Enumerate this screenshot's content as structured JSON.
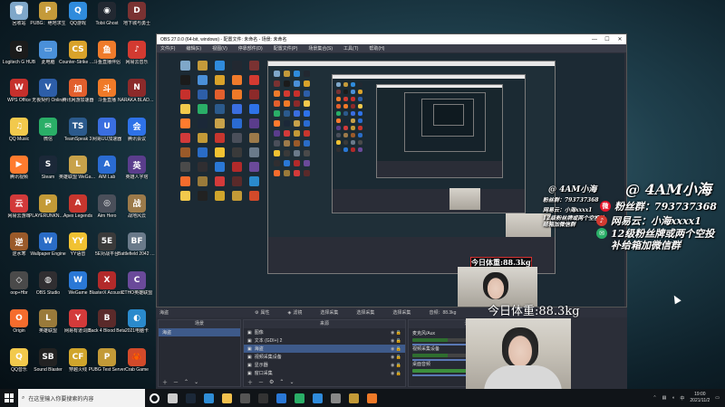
{
  "desktop_icons": [
    {
      "label": "回收站",
      "color": "#7fa7c9",
      "glyph": "🗑"
    },
    {
      "label": "PUBG：绝地求生",
      "color": "#c49a3a",
      "glyph": "P"
    },
    {
      "label": "QQ游戏",
      "color": "#2f8bdc",
      "glyph": "Q"
    },
    {
      "label": "Tobii Ghost",
      "color": "#222831",
      "glyph": "◉"
    },
    {
      "label": "地下城与勇士",
      "color": "#7a3232",
      "glyph": "D"
    },
    {
      "label": "Logitech G HUB",
      "color": "#1b1b1b",
      "glyph": "G"
    },
    {
      "label": "此电脑",
      "color": "#4a90d9",
      "glyph": "▭"
    },
    {
      "label": "Counter-Strike Global Off...",
      "color": "#d9a22a",
      "glyph": "CS"
    },
    {
      "label": "斗鱼直播伴侣",
      "color": "#ef7b2b",
      "glyph": "鱼"
    },
    {
      "label": "网易云音乐",
      "color": "#d33a31",
      "glyph": "♪"
    },
    {
      "label": "WPS Office",
      "color": "#c6302c",
      "glyph": "W"
    },
    {
      "label": "无畏契约 Online",
      "color": "#2d5ea8",
      "glyph": "V"
    },
    {
      "label": "腾讯网游加速器",
      "color": "#e25f2d",
      "glyph": "加"
    },
    {
      "label": "斗鱼直播",
      "color": "#f07a28",
      "glyph": "斗"
    },
    {
      "label": "NARAKA BLADEPOINT",
      "color": "#8c2a2a",
      "glyph": "N"
    },
    {
      "label": "QQ Music",
      "color": "#f2c94c",
      "glyph": "♫"
    },
    {
      "label": "微信",
      "color": "#2aae67",
      "glyph": "✉"
    },
    {
      "label": "TeamSpeak 3",
      "color": "#2b5a8c",
      "glyph": "TS"
    },
    {
      "label": "网易UU加速器",
      "color": "#3a6ee0",
      "glyph": "U"
    },
    {
      "label": "腾讯会议",
      "color": "#2e72e8",
      "glyph": "会"
    },
    {
      "label": "腾讯视频",
      "color": "#ff7b2e",
      "glyph": "▶"
    },
    {
      "label": "Steam",
      "color": "#1b2838",
      "glyph": "S"
    },
    {
      "label": "英雄联盟 WeGame",
      "color": "#c8a24a",
      "glyph": "L"
    },
    {
      "label": "AIM Lab",
      "color": "#2a6bd1",
      "glyph": "A"
    },
    {
      "label": "英雄人字塔",
      "color": "#5a3d8c",
      "glyph": "英"
    },
    {
      "label": "网易云游戏",
      "color": "#d23a3a",
      "glyph": "云"
    },
    {
      "label": "PLAYERUNKNOWN'S BATTLEGROUNDS",
      "color": "#c39a37",
      "glyph": "P"
    },
    {
      "label": "Apex Legends",
      "color": "#c7362e",
      "glyph": "A"
    },
    {
      "label": "Aim Hero",
      "color": "#4a4f5a",
      "glyph": "◎"
    },
    {
      "label": "战地风云",
      "color": "#9c7a4a",
      "glyph": "战"
    },
    {
      "label": "逆水寒",
      "color": "#9a5a2a",
      "glyph": "逆"
    },
    {
      "label": "Wallpaper Engine",
      "color": "#2a6cc6",
      "glyph": "W"
    },
    {
      "label": "YY语音",
      "color": "#f1c232",
      "glyph": "YY"
    },
    {
      "label": "5E对战平台",
      "color": "#3a3a3a",
      "glyph": "5E"
    },
    {
      "label": "Battlefield 2042 Open...",
      "color": "#6a7a8a",
      "glyph": "BF"
    },
    {
      "label": "oop+Hbr",
      "color": "#4a4a4a",
      "glyph": "◇"
    },
    {
      "label": "OBS Studio",
      "color": "#302e31",
      "glyph": "◍"
    },
    {
      "label": "WeGame",
      "color": "#2a78d6",
      "glyph": "W"
    },
    {
      "label": "BlasterX Acoustic",
      "color": "#b22a2a",
      "glyph": "X"
    },
    {
      "label": "CTHO英雄联盟",
      "color": "#6a4a9a",
      "glyph": "C"
    },
    {
      "label": "Origin",
      "color": "#f56c2d",
      "glyph": "O"
    },
    {
      "label": "英雄联盟",
      "color": "#9a7a3a",
      "glyph": "L"
    },
    {
      "label": "网易有道词典",
      "color": "#d33a3a",
      "glyph": "Y"
    },
    {
      "label": "Back 4 Blood Beta",
      "color": "#5a2a2a",
      "glyph": "B"
    },
    {
      "label": "2021电脑卡",
      "color": "#2a8acc",
      "glyph": "◐"
    },
    {
      "label": "QQ音乐",
      "color": "#f2c94c",
      "glyph": "Q"
    },
    {
      "label": "Sound Blaster",
      "color": "#222",
      "glyph": "SB"
    },
    {
      "label": "穿越火线",
      "color": "#d0a52c",
      "glyph": "CF"
    },
    {
      "label": "PUBG Test Server",
      "color": "#c39a37",
      "glyph": "P"
    },
    {
      "label": "Crab Game",
      "color": "#d24a2a",
      "glyph": "🦀"
    }
  ],
  "obs": {
    "title": "OBS 27.0.0 (64-bit, windows) - 配置文件: 未命名 - 场景: 未命名",
    "menu": [
      "文件(F)",
      "编辑(E)",
      "视图(V)",
      "停靠部件(D)",
      "配置文件(P)",
      "场景集合(S)",
      "工具(T)",
      "帮助(H)"
    ],
    "dock_strip": {
      "scene_label": "海盗",
      "tab_props": "属性",
      "tab_filters": "滤镜",
      "tab_source1": "选择采集",
      "tab_source2": "选择采集",
      "tab_capture": "选择采集",
      "tab_audio": "音频：88.3kg"
    },
    "scenes_panel": {
      "header": "场景",
      "items": [
        "海盗"
      ]
    },
    "sources_panel": {
      "header": "来源",
      "items": [
        "图像",
        "文本 (GDI+) 2",
        "海盗",
        "视频采集设备",
        "显示器",
        "窗口采集"
      ]
    },
    "mixer_panel": {
      "header": "混音器",
      "channels": [
        {
          "name": "麦克风/Aux",
          "db": "0.0 dB"
        },
        {
          "name": "视频采集设备",
          "db": "0.0 dB"
        },
        {
          "name": "桌面音频",
          "db": "-1.4 dB"
        }
      ]
    }
  },
  "overlay": {
    "handle": "@ 4AM小海",
    "fan_group": "粉丝群：793737368",
    "netease": "网易云：小海xxxx1",
    "wechat": "12级粉丝牌或两个空投补给箱加微信群",
    "weight": "今日体重:88.3kg"
  },
  "taskbar": {
    "search_placeholder": "在这里输入你要搜索的内容",
    "time": "19:00",
    "date": "2021/11/2",
    "lang": "中",
    "icons": [
      {
        "name": "cortana",
        "color": "#ffffff"
      },
      {
        "name": "task-view",
        "color": "#cccccc"
      },
      {
        "name": "steam",
        "color": "#1b2838"
      },
      {
        "name": "edge",
        "color": "#2f8dd6"
      },
      {
        "name": "file-explorer",
        "color": "#f2c14e"
      },
      {
        "name": "obs",
        "color": "#555555"
      },
      {
        "name": "logitech",
        "color": "#333333"
      },
      {
        "name": "wegame",
        "color": "#2a78d6"
      },
      {
        "name": "wechat",
        "color": "#2aae67"
      },
      {
        "name": "qq",
        "color": "#2f8bdc"
      },
      {
        "name": "settings",
        "color": "#888888"
      },
      {
        "name": "pubg",
        "color": "#c39a37"
      },
      {
        "name": "douyu",
        "color": "#f07a28"
      }
    ]
  }
}
